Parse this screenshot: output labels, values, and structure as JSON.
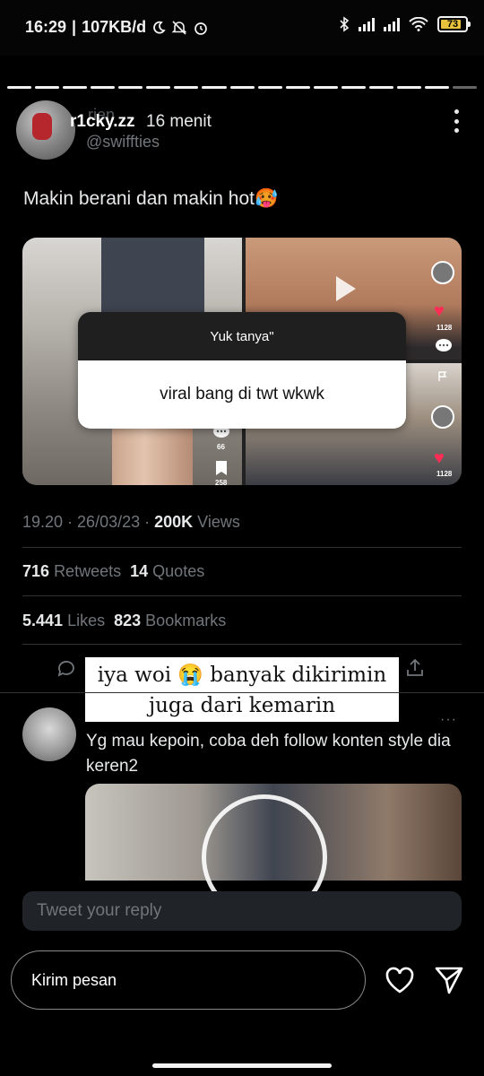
{
  "status_bar": {
    "time": "16:29",
    "net_speed": "107KB/d",
    "battery": "73"
  },
  "tweet": {
    "avatar": "profile-photo",
    "display_name": "r1cky.zz",
    "overlapping_text": "rien",
    "time_ago": "16 menit",
    "handle": "@swiffties",
    "text": "Makin berani dan makin hot🥵",
    "media_sticker": {
      "prompt": "Yuk tanya\"",
      "answer": "viral bang di twt wkwk"
    },
    "media_counts": {
      "likes_a": "1128",
      "comments": "66",
      "saves": "258",
      "likes_b": "1128"
    },
    "meta": {
      "time": "19.20",
      "date": "26/03/23",
      "views_count": "200K",
      "views_label": "Views"
    },
    "stats": {
      "retweets_count": "716",
      "retweets_label": "Retweets",
      "quotes_count": "14",
      "quotes_label": "Quotes",
      "likes_count": "5.441",
      "likes_label": "Likes",
      "bookmarks_count": "823",
      "bookmarks_label": "Bookmarks"
    }
  },
  "caption_overlay": {
    "line1": "iya woi 😭 banyak dikirimin",
    "line2": "juga dari kemarin"
  },
  "reply": {
    "text": "Yg mau kepoin, coba deh follow konten style dia keren2",
    "more": "···"
  },
  "reply_field": {
    "placeholder": "Tweet your reply"
  },
  "message_bar": {
    "placeholder": "Kirim pesan"
  },
  "icons": [
    "moon-icon",
    "mute-icon",
    "alarm-icon",
    "bluetooth-icon",
    "signal-icon",
    "wifi-icon",
    "battery-icon",
    "more-vertical-icon",
    "play-icon",
    "heart-icon",
    "comment-icon",
    "bookmark-icon",
    "flag-icon",
    "reply-icon",
    "share-icon",
    "send-icon"
  ]
}
